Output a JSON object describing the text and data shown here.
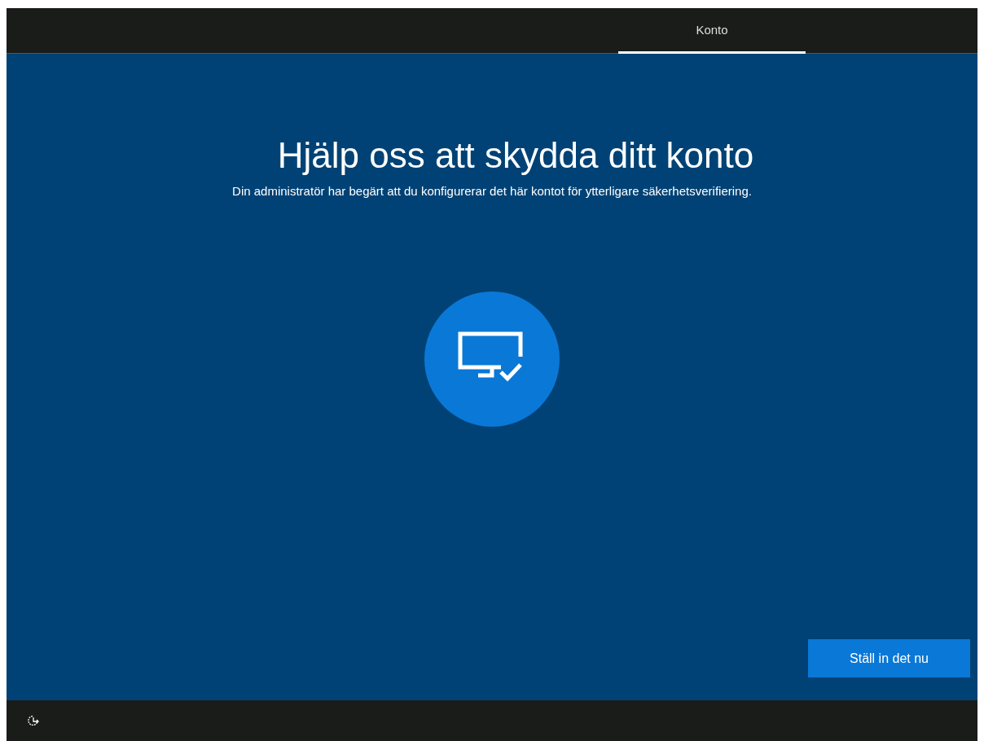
{
  "steps": [
    {
      "label": "Konto",
      "selected": true
    }
  ],
  "title": "Hjälp oss att skydda ditt konto",
  "subtitle": "Din administratör har begärt att du konfigurerar det här kontot för ytterligare säkerhetsverifiering.",
  "button": "Ställ in det nu"
}
